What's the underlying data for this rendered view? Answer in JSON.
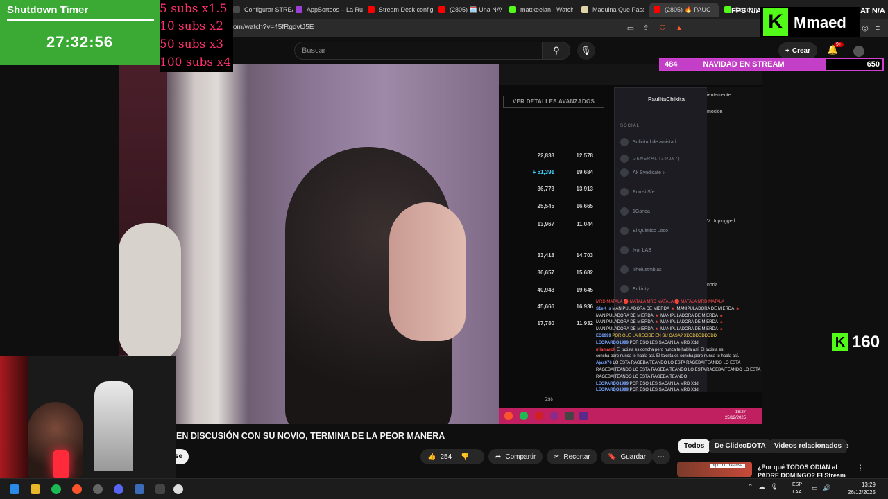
{
  "browser": {
    "tabs": [
      {
        "label": "Configurar STREAM",
        "color": "#4a4a4a"
      },
      {
        "label": "AppSorteos – La Ru",
        "color": "#9b3fd6"
      },
      {
        "label": "Stream Deck config",
        "color": "#ff0000"
      },
      {
        "label": "(2805) 🗓️ Una NAV",
        "color": "#ff0000"
      },
      {
        "label": "mattkeelan - Watch",
        "color": "#53fc18"
      },
      {
        "label": "Maquina Que Pasa",
        "color": "#e0d3a8"
      },
      {
        "label": "(2805) 🔥 PAUC",
        "color": "#ff0000",
        "active": true
      },
      {
        "label": "Dandenh",
        "color": "#53fc18"
      }
    ],
    "close_tab_glyph": "✕",
    "url": "om/watch?v=45fRgdvtJ5E"
  },
  "youtube": {
    "search_placeholder": "Buscar",
    "search_icon": "search-icon",
    "mic_icon": "mic-icon",
    "create_label": "Crear",
    "notification_badge": "9+",
    "video_title": "EN DISCUSIÓN CON SU NOVIO, TERMINA DE LA PEOR MANERA",
    "subscribe_partial": "se",
    "likes": "254",
    "share_label": "Compartir",
    "clip_label": "Recortar",
    "save_label": "Guardar",
    "chips": [
      "Todos",
      "De ClideoDOTA",
      "Videos relacionados"
    ],
    "recommended": {
      "title": "¿Por qué TODOS ODIAN al PADRE DOMINGO? El Stream",
      "thumb_caption": "pipo: no das risa."
    }
  },
  "capture": {
    "details_button": "VER DETALLES AVANZADOS",
    "stats": [
      {
        "a": "22,833",
        "b": "12,578"
      },
      {
        "a": "+ 51,391",
        "b": "19,684"
      },
      {
        "a": "36,773",
        "b": "13,913"
      },
      {
        "a": "25,545",
        "b": "16,665"
      },
      {
        "a": "13,967",
        "b": "11,044"
      },
      {
        "a": "33,418",
        "b": "14,703"
      },
      {
        "a": "36,657",
        "b": "15,682"
      },
      {
        "a": "40,948",
        "b": "19,645"
      },
      {
        "a": "45,666",
        "b": "16,936"
      },
      {
        "a": "17,780",
        "b": "11,932"
      }
    ],
    "social": {
      "name": "PaulitaChikita",
      "section": "SOCIAL",
      "request": "Solicitud de amistad",
      "group": "GENERAL (26/197)",
      "friends": [
        "Ak Syndicate ♪",
        "Poolsi Sfe",
        "1Ganda",
        "El Quimico Loco",
        "Ivor LAS",
        "Thelustmblas",
        "Enkirity"
      ]
    },
    "side": {
      "item1": "ientemente",
      "item2": "moción",
      "item3": "V Unplugged",
      "item4": "noria"
    },
    "chat": [
      {
        "u": "",
        "t": "MRD MATALA 🔴 MATALA MRD MATALA 🔴 MATALA MRD MATALA"
      },
      {
        "u": "S1eK_s",
        "t": "MANIPULADORA DE MIERDA 🔺 MANIPULADORA DE MIERDA 🔺"
      },
      {
        "u": "",
        "t": "MANIPULADORA DE MIERDA 🔺 MANIPULADORA DE MIERDA 🔺"
      },
      {
        "u": "",
        "t": "MANIPULADORA DE MIERDA 🔺 MANIPULADORA DE MIERDA 🔺"
      },
      {
        "u": "",
        "t": "MANIPULADORA DE MIERDA 🔺 MANIPULADORA DE MIERDA 🔺"
      },
      {
        "u": "ED8999",
        "t": "POR QUE LA RECIBE EN SU CASA? XDDDDDDDDDD"
      },
      {
        "u": "LEOPARDO1999",
        "t": "POR ESO LES SACAN LA MRD Xdd"
      },
      {
        "u": "miamarok",
        "t": "El taxista es concha pero nunca te habla así. El taxista es"
      },
      {
        "u": "",
        "t": "concha pero nunca te habla así. El taxista es concha pero nunca te habla así."
      },
      {
        "u": "Ajax676",
        "t": "LO ESTA RAGEBAITEANDO LO ESTA RAGEBAITEANDO LO ESTA"
      },
      {
        "u": "",
        "t": "RAGEBAITEANDO LO ESTA RAGEBAITEANDO LO ESTA RAGEBAITEANDO LO ESTA"
      },
      {
        "u": "",
        "t": "RAGEBAITEANDO LO ESTA RAGEBAITEANDO"
      },
      {
        "u": "LEOPARDO1999",
        "t": "POR ESO LES SACAN LA MRD Xdd"
      },
      {
        "u": "LEOPARDO1999",
        "t": "POR ESO LES SACAN LA MRD Xdd"
      }
    ],
    "inner_time": "18:27",
    "inner_date": "25/12/2025",
    "scrub_time": "5:36"
  },
  "overlays": {
    "shutdown_title": "Shutdown Timer",
    "shutdown_time": "27:32:56",
    "multipliers": [
      "5 subs x1.5",
      "10 subs x2",
      "50 subs x3",
      "100 subs x4"
    ],
    "kick_logo": "K",
    "kick_name": "Mmaed",
    "fps_left": "FPS N/A",
    "fps_right": "AT N/A",
    "goal": {
      "current": "484",
      "title": "NAVIDAD EN STREAM",
      "target": "650",
      "progress": 0.745
    },
    "kick_count": "160",
    "accent_green": "#53fc18",
    "accent_pink": "#d23fd2"
  },
  "taskbar": {
    "lang_top": "ESP",
    "lang_bottom": "LAA",
    "time": "13:29",
    "date": "26/12/2025"
  }
}
